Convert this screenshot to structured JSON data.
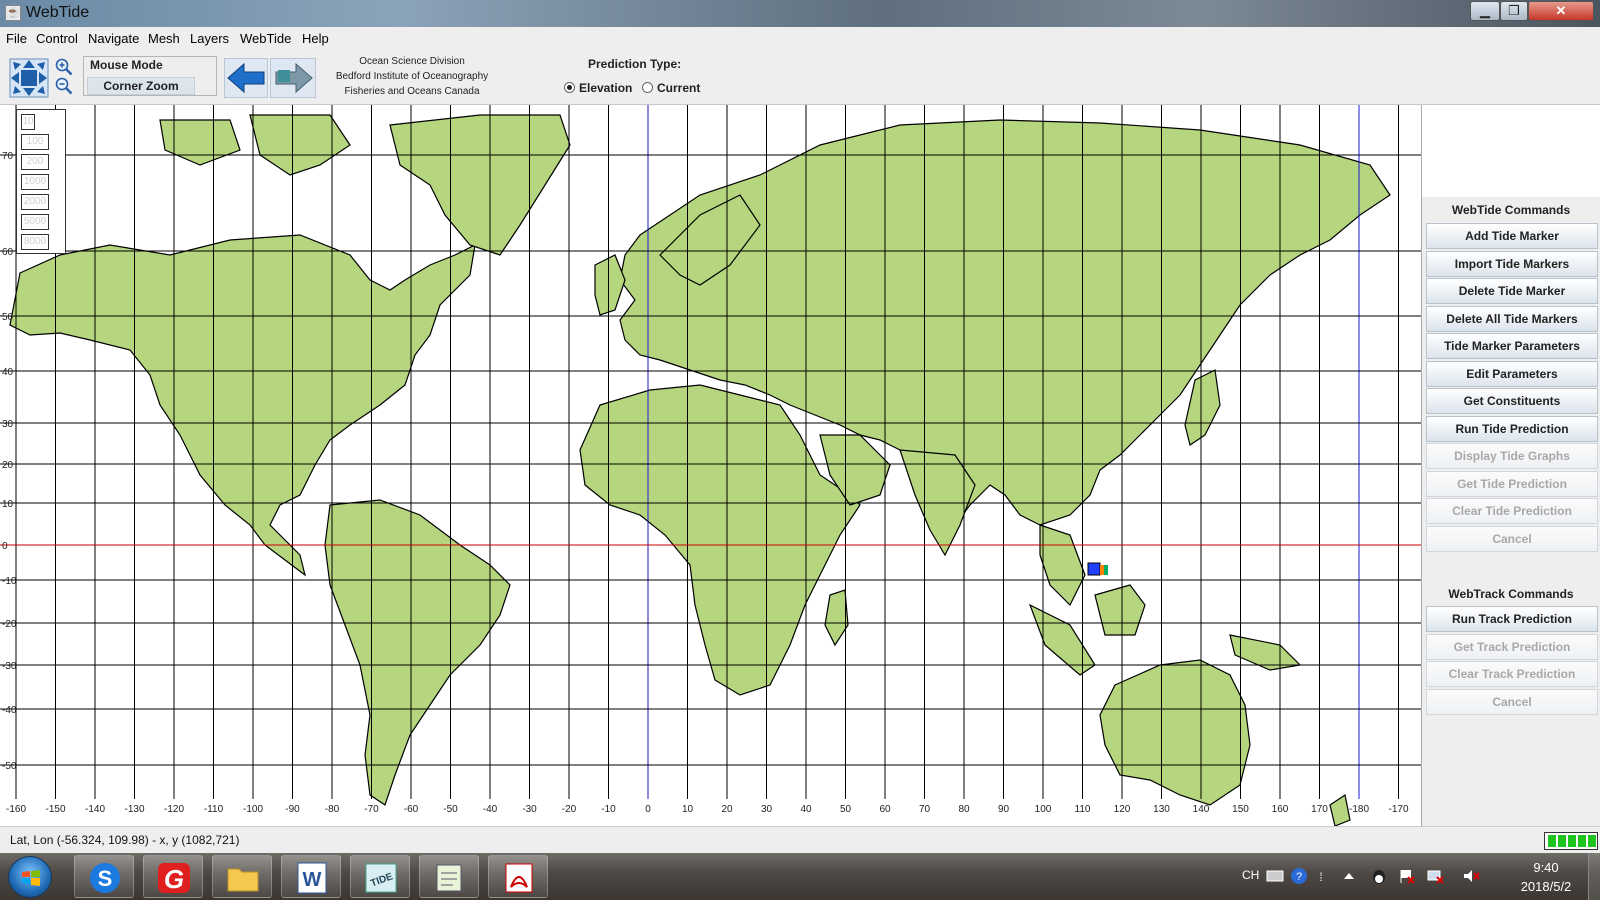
{
  "window": {
    "title": "WebTide"
  },
  "menu": [
    "File",
    "Control",
    "Navigate",
    "Mesh",
    "Layers",
    "WebTide",
    "Help"
  ],
  "toolbar": {
    "mouse_mode_label": "Mouse Mode",
    "mouse_mode_value": "Corner Zoom",
    "org_lines": [
      "Ocean Science Division",
      "Bedford Institute of Oceanography",
      "Fisheries and Oceans Canada"
    ],
    "prediction_type_label": "Prediction Type:",
    "prediction_options": [
      "Elevation",
      "Current"
    ],
    "prediction_selected": "Elevation"
  },
  "map": {
    "lat_labels": [
      "70",
      "60",
      "50",
      "40",
      "30",
      "20",
      "10",
      "0",
      "-10",
      "-20",
      "-30",
      "-40",
      "-50"
    ],
    "lon_labels": [
      "-160",
      "-150",
      "-140",
      "-130",
      "-120",
      "-110",
      "-100",
      "-90",
      "-80",
      "-70",
      "-60",
      "-50",
      "-40",
      "-30",
      "-20",
      "-10",
      "0",
      "10",
      "20",
      "30",
      "40",
      "50",
      "60",
      "70",
      "80",
      "90",
      "100",
      "110",
      "120",
      "130",
      "140",
      "150",
      "160",
      "170",
      "-180",
      "-170"
    ],
    "depth_legend": [
      "10",
      "100",
      "200",
      "1000",
      "2000",
      "5000",
      "8000"
    ],
    "colors": {
      "land": "#b5d67f",
      "water": "#ffffff",
      "grid": "#000000",
      "equator": "#cc0000",
      "meridian": "#1a1acc"
    }
  },
  "panel": {
    "webtide_title": "WebTide Commands",
    "webtide_commands": [
      {
        "label": "Add Tide Marker",
        "enabled": true
      },
      {
        "label": "Import Tide Markers",
        "enabled": true
      },
      {
        "label": "Delete Tide Marker",
        "enabled": true
      },
      {
        "label": "Delete All Tide Markers",
        "enabled": true
      },
      {
        "label": "Tide Marker Parameters",
        "enabled": true
      },
      {
        "label": "Edit Parameters",
        "enabled": true
      },
      {
        "label": "Get Constituents",
        "enabled": true
      },
      {
        "label": "Run Tide Prediction",
        "enabled": true
      },
      {
        "label": "Display Tide Graphs",
        "enabled": false
      },
      {
        "label": "Get Tide Prediction",
        "enabled": false
      },
      {
        "label": "Clear Tide Prediction",
        "enabled": false
      },
      {
        "label": "Cancel",
        "enabled": false
      }
    ],
    "webtrack_title": "WebTrack Commands",
    "webtrack_commands": [
      {
        "label": "Run Track Prediction",
        "enabled": true
      },
      {
        "label": "Get Track Prediction",
        "enabled": false
      },
      {
        "label": "Clear Track Prediction",
        "enabled": false
      },
      {
        "label": "Cancel",
        "enabled": false
      }
    ]
  },
  "status": {
    "text": "Lat, Lon (-56.324, 109.98) - x, y (1082,721)"
  },
  "taskbar": {
    "lang": "CH",
    "time": "9:40",
    "date": "2018/5/2"
  }
}
